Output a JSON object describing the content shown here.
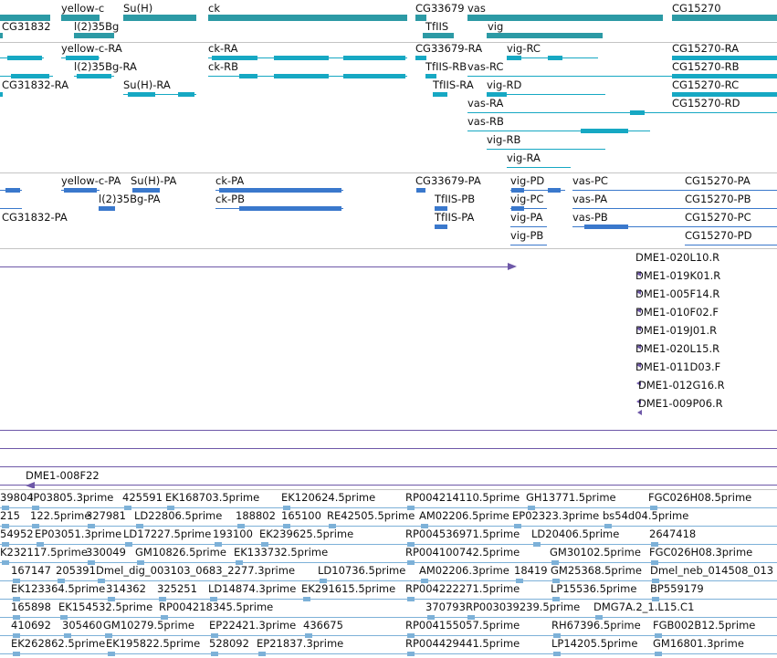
{
  "colors": {
    "gene": "#2c9aa5",
    "transcript": "#16a8c3",
    "protein": "#3a78cc",
    "clone": "#6e58a8",
    "est": "#7db1d8",
    "separator": "#c4c4c4"
  },
  "genes_track": {
    "labels": [
      "CG31832",
      "yellow-c",
      "l(2)35Bg",
      "Su(H)",
      "ck",
      "CG33679",
      "vas",
      "TfIIS",
      "vig",
      "CG15270"
    ]
  },
  "transcripts_track": {
    "labels": [
      "yellow-c-RA",
      "l(2)35Bg-RA",
      "CG31832-RA",
      "Su(H)-RA",
      "ck-RA",
      "ck-RB",
      "CG33679-RA",
      "TfIIS-RB",
      "TfIIS-RA",
      "vas-RC",
      "vig-RC",
      "vig-RD",
      "vas-RA",
      "vas-RB",
      "vig-RB",
      "vig-RA",
      "CG15270-RA",
      "CG15270-RB",
      "CG15270-RC",
      "CG15270-RD"
    ]
  },
  "proteins_track": {
    "labels": [
      "yellow-c-PA",
      "Su(H)-PA",
      "l(2)35Bg-PA",
      "CG31832-PA",
      "ck-PA",
      "ck-PB",
      "CG33679-PA",
      "TfIIS-PB",
      "TfIIS-PA",
      "vig-PD",
      "vig-PC",
      "vig-PA",
      "vig-PB",
      "vas-PC",
      "vas-PA",
      "vas-PB",
      "CG15270-PA",
      "CG15270-PB",
      "CG15270-PC",
      "CG15270-PD"
    ]
  },
  "clones_track": {
    "labels": [
      "DME1-020L10.R",
      "DME1-019K01.R",
      "DME1-005F14.R",
      "DME1-010F02.F",
      "DME1-019J01.R",
      "DME1-020L15.R",
      "DME1-011D03.F",
      "DME1-012G16.R",
      "DME1-009P06.R",
      "DME1-008F22"
    ]
  },
  "est_track": {
    "labels": [
      "39804",
      "IP03805.3prime",
      "425591",
      "EK168703.5prime",
      "EK120624.5prime",
      "RP004214110.5prime",
      "GH13771.5prime",
      "FGC026H08.5prime",
      "215",
      "122.5prime",
      "327981",
      "LD22806.5prime",
      "188802",
      "165100",
      "RE42505.5prime",
      "AM02206.5prime",
      "EP02323.3prime",
      "bs54d04.5prime",
      "54952",
      "EP03051.3prime",
      "LD17227.5prime",
      "193100",
      "EK239625.5prime",
      "RP004536971.5prime",
      "LD20406.5prime",
      "2647418",
      "K232117.5prime",
      "330049",
      "GM10826.5prime",
      "EK133732.5prime",
      "RP004100742.5prime",
      "GM30102.5prime",
      "FGC026H08.3prime",
      "167147",
      "205391",
      "Dmel_dig_003103_0683_2277.3prime",
      "LD10736.5prime",
      "AM02206.3prime",
      "18419",
      "GM25368.5prime",
      "Dmel_neb_014508_013",
      "EK123364.5prime",
      "314362",
      "325251",
      "LD14874.3prime",
      "EK291615.5prime",
      "RP004222271.5prime",
      "LP15536.5prime",
      "BP559179",
      "165898",
      "EK154532.5prime",
      "RP004218345.5prime",
      "370793",
      "RP003039239.5prime",
      "DMG7A.2_1.L15.C1",
      "410692",
      "305460",
      "GM10279.5prime",
      "EP22421.3prime",
      "436675",
      "RP004155057.5prime",
      "RH67396.5prime",
      "FGB002B12.5prime",
      "EK262862.5prime",
      "EK195822.5prime",
      "528092",
      "EP21837.3prime",
      "RP004429441.5prime",
      "LP14205.5prime",
      "GM16801.3prime"
    ]
  }
}
